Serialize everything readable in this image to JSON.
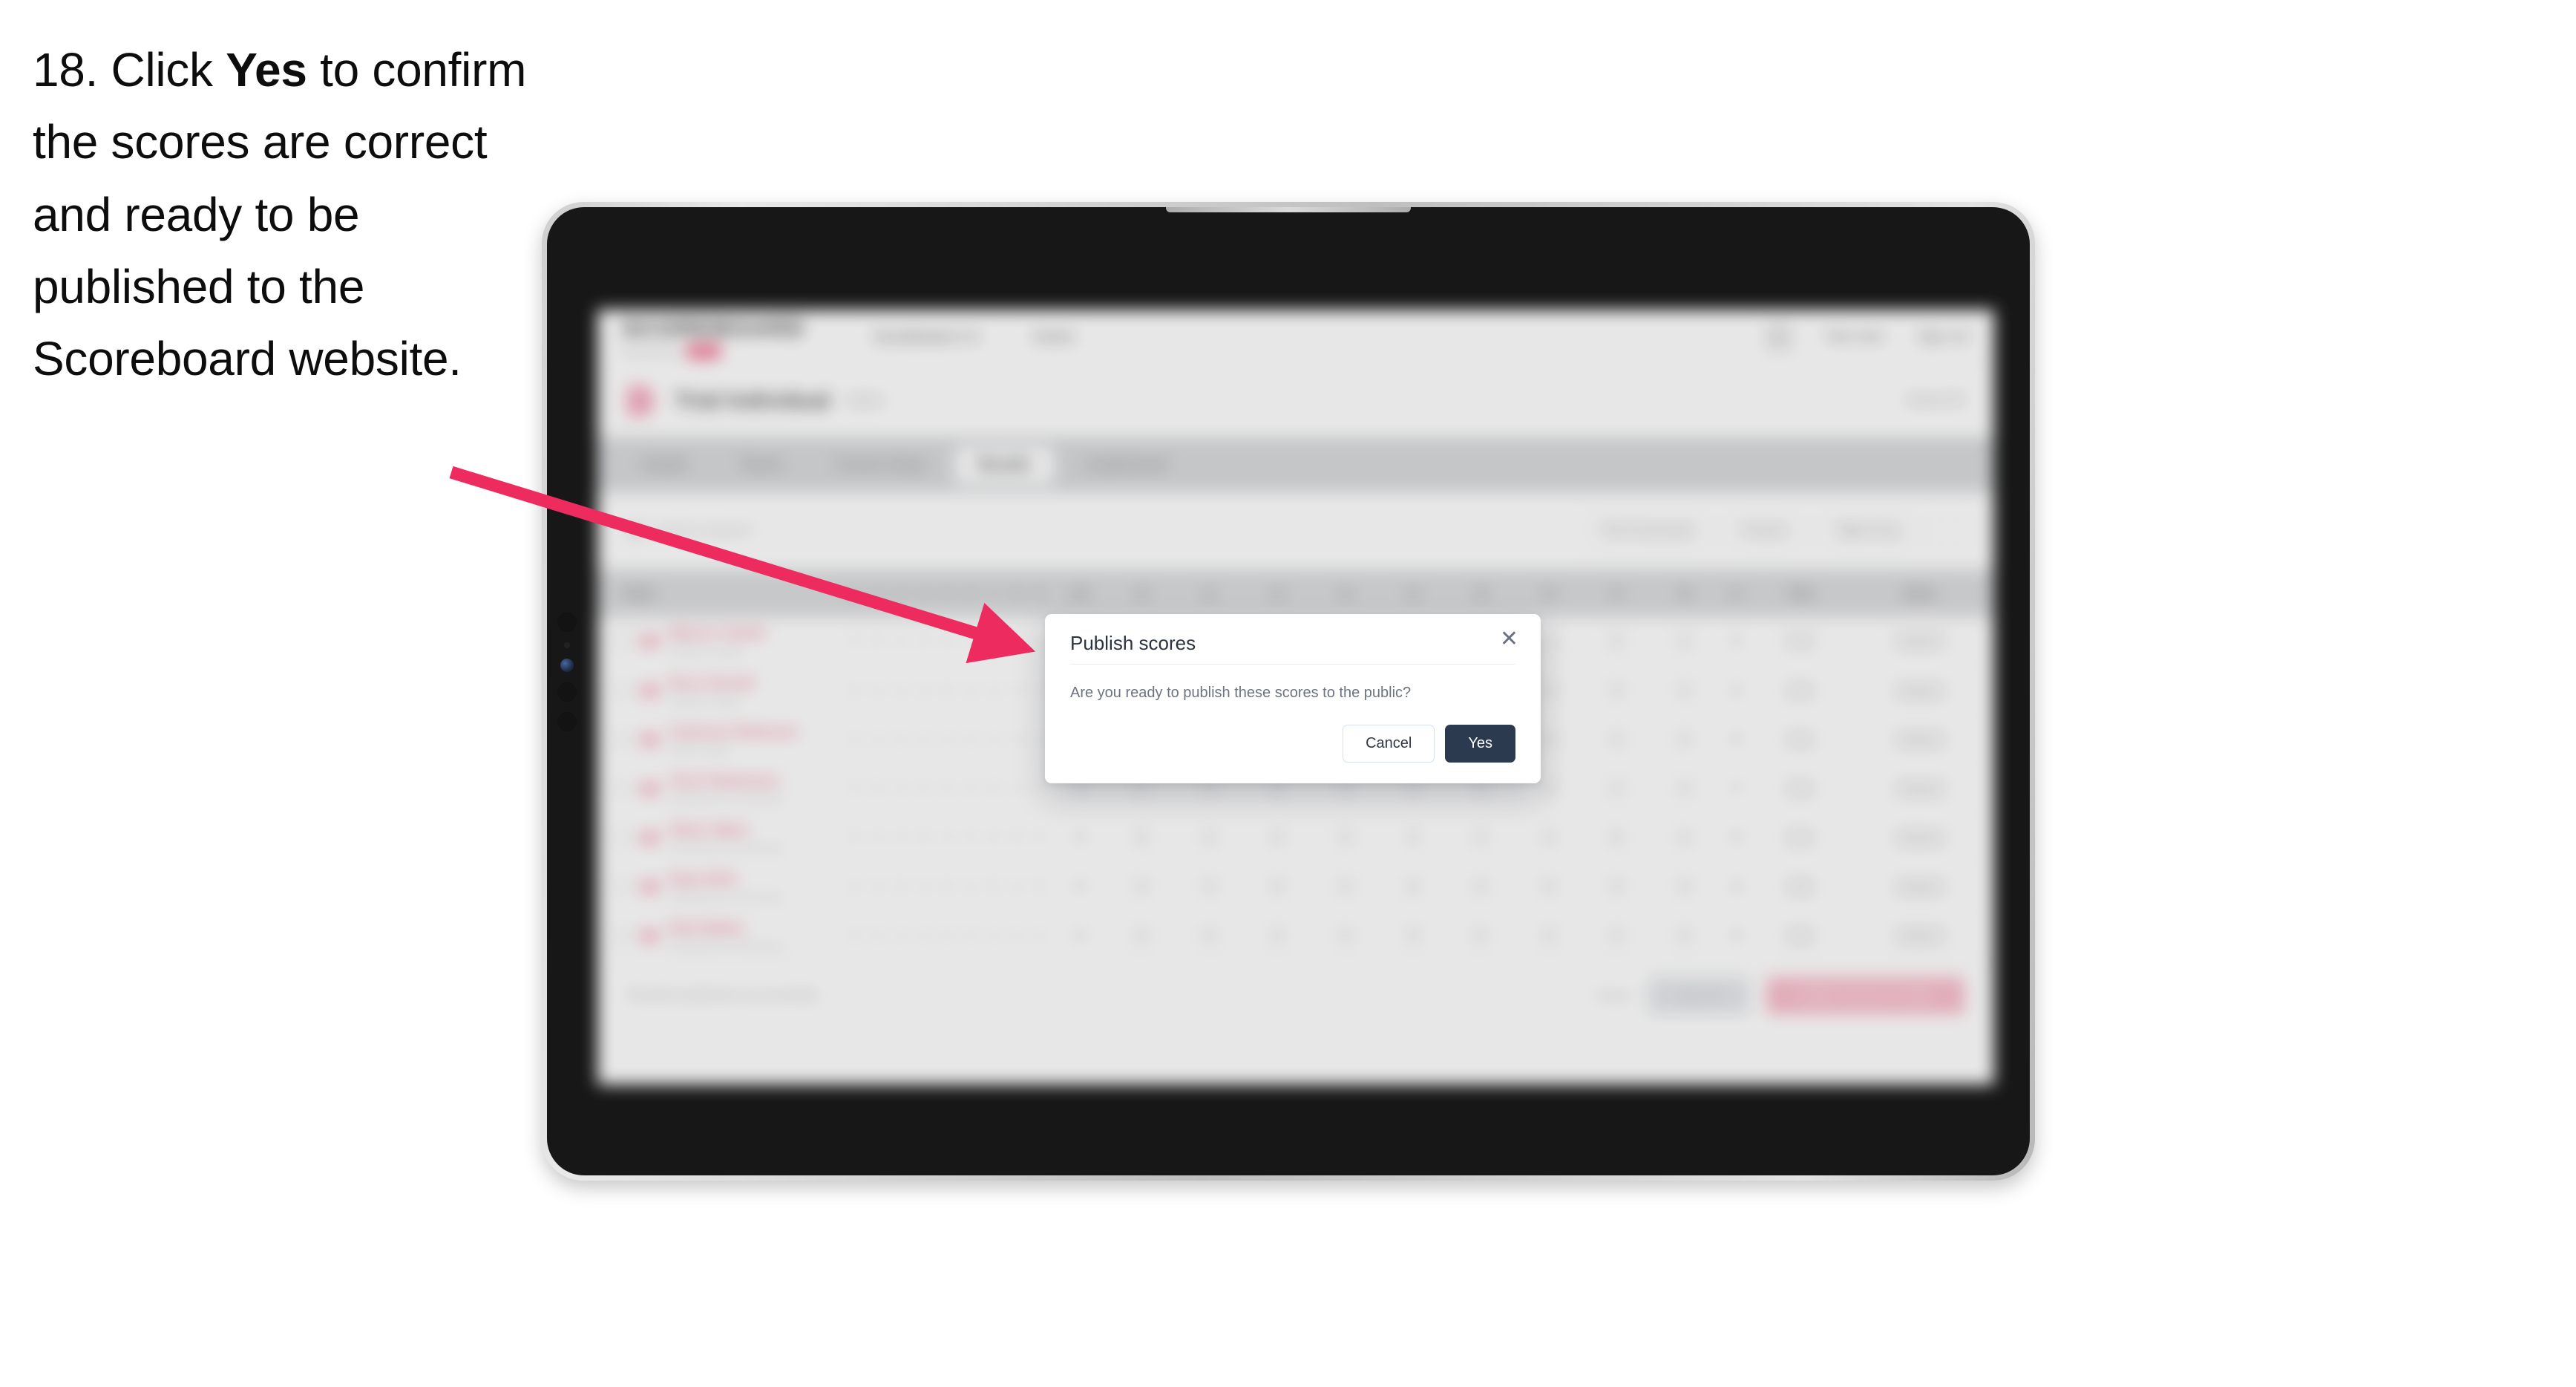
{
  "caption": {
    "prefix": "18. Click ",
    "bold": "Yes",
    "suffix": " to confirm the scores are correct and ready to be published to the Scoreboard website."
  },
  "annotation": {
    "arrow_color": "#EE2B5E",
    "points_to": "yes-button"
  },
  "device": {
    "type": "tablet",
    "bezel_color": "#090909",
    "frame_color": "#cfcfcf"
  },
  "app": {
    "brand": {
      "name": "SCOREBOARD",
      "tagline": "Powered by",
      "badge": "RFU"
    },
    "nav": [
      {
        "label": "Scoreboard 2.0"
      },
      {
        "label": "Event"
      }
    ],
    "topbar_right": [
      {
        "label": "Test User"
      },
      {
        "label": "Sign out"
      }
    ],
    "breadcrumb": {
      "icon": "event-badge-icon",
      "title": "Trial Individual",
      "chip": "2024",
      "right_label": "Event ID"
    },
    "tabs": [
      {
        "label": "Details",
        "active": false
      },
      {
        "label": "Teams",
        "active": false
      },
      {
        "label": "Course Setup",
        "active": false
      },
      {
        "label": "Results",
        "active": true
      },
      {
        "label": "Leaderboard",
        "active": false
      }
    ],
    "filters": {
      "search_placeholder": "Search players",
      "buttons": [
        {
          "label": "Print Scorecard"
        },
        {
          "label": "Present"
        }
      ],
      "select_label": "Table Entry",
      "icon_button": "settings-icon"
    },
    "table": {
      "columns": [
        "Player",
        "1",
        "2",
        "3",
        "4",
        "5",
        "6",
        "7",
        "8",
        "9",
        "Out",
        "10",
        "11",
        "12",
        "13",
        "14",
        "15",
        "16",
        "17",
        "18",
        "In",
        "Total",
        "Status"
      ],
      "rows": [
        {
          "name": "Warren Tomlin",
          "club": "Dragon's Lodge",
          "scores": [
            "4",
            "5",
            "4",
            "3",
            "5",
            "4",
            "4",
            "3",
            "4"
          ],
          "out": "36",
          "in_": "35",
          "total": "71",
          "status": "Signed"
        },
        {
          "name": "Ross Parnell",
          "club": "Dragon's Ridge",
          "scores": [
            "5",
            "4",
            "4",
            "4",
            "5",
            "4",
            "3",
            "4",
            "4"
          ],
          "out": "37",
          "in_": "36",
          "total": "73",
          "status": "Signed"
        },
        {
          "name": "Cameron Robinson",
          "club": "Rother Valley",
          "scores": [
            "4",
            "4",
            "5",
            "4",
            "4",
            "5",
            "4",
            "4",
            "4"
          ],
          "out": "38",
          "in_": "36",
          "total": "74",
          "status": "Signed"
        },
        {
          "name": "Chris Robertson",
          "club": "Southbourne Community",
          "scores": [
            "4",
            "5",
            "4",
            "4",
            "4",
            "4",
            "5",
            "4",
            "4"
          ],
          "out": "38",
          "in_": "37",
          "total": "75",
          "status": "Signed"
        },
        {
          "name": "Oliver Ward",
          "club": "Southbourne Community",
          "scores": [
            "5",
            "4",
            "4",
            "5",
            "4",
            "4",
            "4",
            "5",
            "4"
          ],
          "out": "39",
          "in_": "38",
          "total": "77",
          "status": "Signed"
        },
        {
          "name": "Ryan Britt",
          "club": "Southbourne Community",
          "scores": [
            "4",
            "4",
            "5",
            "4",
            "5",
            "4",
            "5",
            "4",
            "5"
          ],
          "out": "40",
          "in_": "38",
          "total": "78",
          "status": "Signed"
        },
        {
          "name": "Nick Bailey",
          "club": "Southbourne Community",
          "scores": [
            "5",
            "5",
            "4",
            "4",
            "5",
            "5",
            "4",
            "4",
            "4"
          ],
          "out": "40",
          "in_": "39",
          "total": "79",
          "status": "Signed"
        }
      ]
    },
    "footer": {
      "note": "Results published successfully",
      "link": "Reset",
      "secondary_button": "Save All",
      "primary_button": "Publish Scores to Public"
    }
  },
  "modal": {
    "title": "Publish scores",
    "close_icon": "close-icon",
    "message": "Are you ready to publish these scores to the public?",
    "cancel_label": "Cancel",
    "confirm_label": "Yes",
    "confirm_color": "#2C3A50"
  }
}
